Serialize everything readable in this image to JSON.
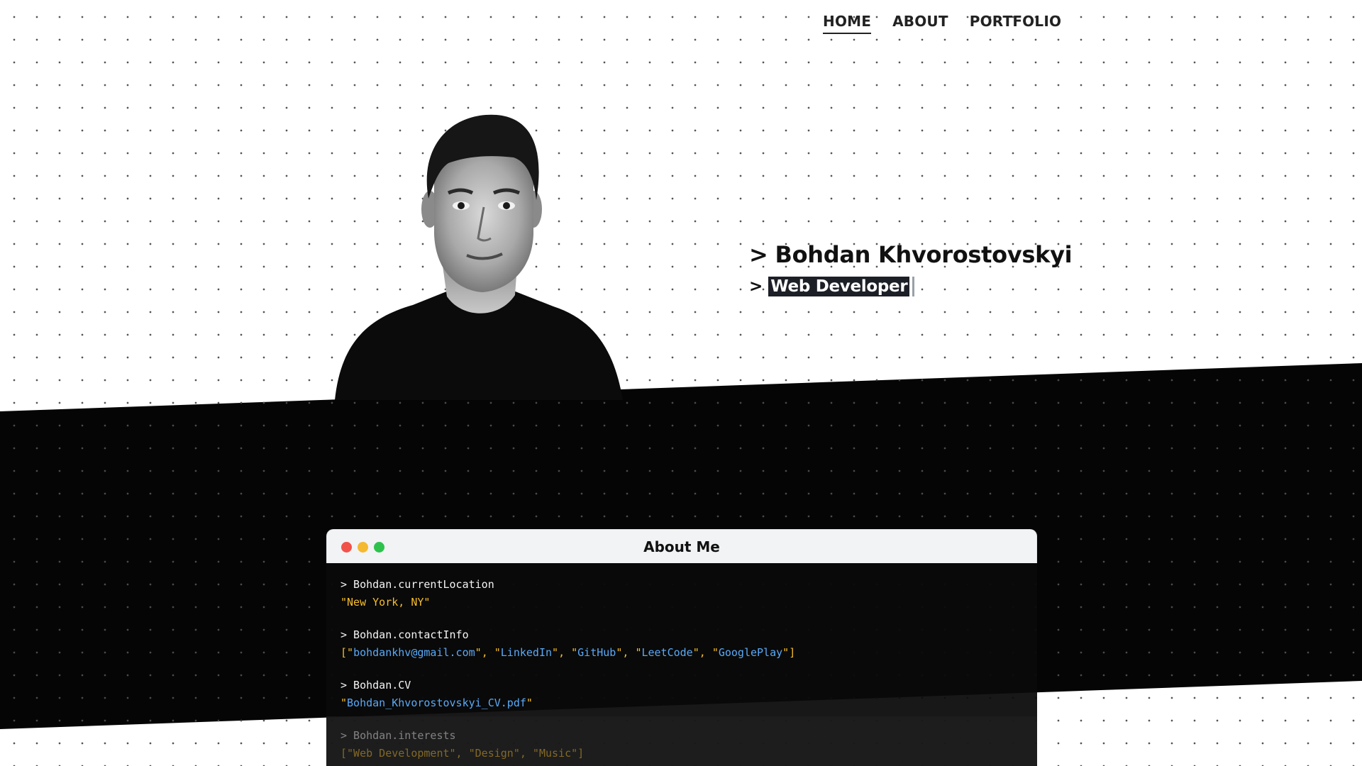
{
  "nav": {
    "items": [
      {
        "label": "HOME",
        "active": true
      },
      {
        "label": "ABOUT",
        "active": false
      },
      {
        "label": "PORTFOLIO",
        "active": false
      }
    ]
  },
  "hero": {
    "prompt": ">",
    "name": "Bohdan Khvorostovskyi",
    "role": "Web Developer"
  },
  "terminal": {
    "title": "About Me",
    "entries": [
      {
        "command": "> Bohdan.currentLocation",
        "result": "\"New York, NY\""
      },
      {
        "command": "> Bohdan.contactInfo",
        "result_links": [
          "bohdankhv@gmail.com",
          "LinkedIn",
          "GitHub",
          "LeetCode",
          "GooglePlay"
        ]
      },
      {
        "command": "> Bohdan.CV",
        "result_link": "Bohdan_Khvorostovskyi_CV.pdf"
      },
      {
        "command": "> Bohdan.interests",
        "result": "[\"Web Development\", \"Design\", \"Music\"]"
      }
    ]
  },
  "colors": {
    "accent_yellow": "#f5bd2a",
    "link_blue": "#5aa9f6",
    "dark": "#050505"
  }
}
